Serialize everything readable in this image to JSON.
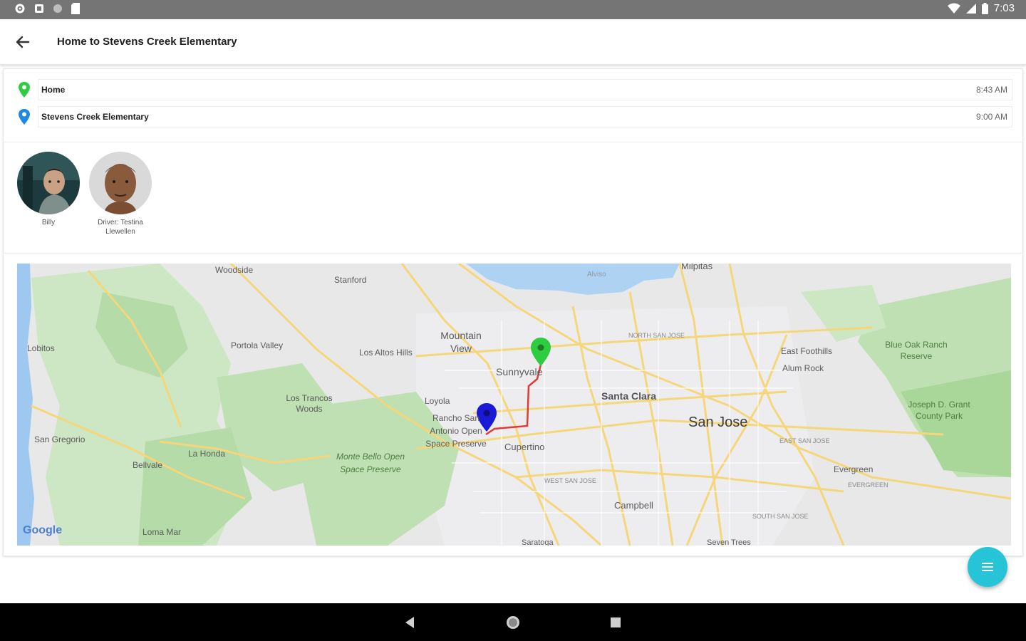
{
  "status_bar": {
    "time": "7:03"
  },
  "app_bar": {
    "title": "Home to Stevens Creek Elementary"
  },
  "stops": [
    {
      "name": "Home",
      "time": "8:43 AM",
      "pin_color": "#2ecc40"
    },
    {
      "name": "Stevens Creek Elementary",
      "time": "9:00 AM",
      "pin_color": "#1e88e5"
    }
  ],
  "people": [
    {
      "label": "Billy"
    },
    {
      "label": "Driver: Testina Llewellen"
    }
  ],
  "map": {
    "labels": [
      "Woodside",
      "Stanford",
      "Alviso",
      "Milpitas",
      "Mountain View",
      "NORTH SAN JOSE",
      "Lobitos",
      "Portola Valley",
      "Los Altos Hills",
      "Sunnyvale",
      "East Foothills",
      "Alum Rock",
      "Blue Oak Ranch Reserve",
      "Los Trancos Woods",
      "Loyola",
      "Santa Clara",
      "Rancho San Antonio Open Space Preserve",
      "San Jose",
      "Joseph D. Grant County Park",
      "San Gregorio",
      "La Honda",
      "Cupertino",
      "EAST SAN JOSE",
      "Bellvale",
      "Monte Bello Open Space Preserve",
      "Evergreen",
      "WEST SAN JOSE",
      "EVERGREEN",
      "Campbell",
      "SOUTH SAN JOSE",
      "Loma Mar",
      "Saratoga",
      "Seven Trees"
    ],
    "attribution": "Google",
    "origin_pin_color": "#2ecc40",
    "destination_pin_color": "#1a1ad6",
    "route_color": "#e53935"
  },
  "fab": {
    "icon": "menu-icon",
    "color": "#27c4d8"
  }
}
